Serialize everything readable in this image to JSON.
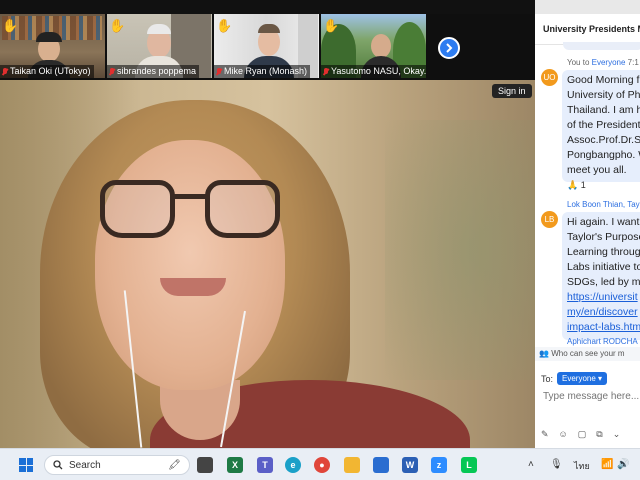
{
  "meeting": {
    "thumbnails": [
      {
        "name": "Taikan Oki (UTokyo)",
        "hand": true,
        "muted": true
      },
      {
        "name": "sibrandes poppema",
        "hand": true,
        "muted": true
      },
      {
        "name": "Mike Ryan (Monash)",
        "hand": true,
        "muted": true
      },
      {
        "name": "Yasutomo NASU, Okay...",
        "hand": true,
        "muted": true
      }
    ],
    "signin_label": "Sign in"
  },
  "chat": {
    "title": "University Presidents M",
    "messages": [
      {
        "avatar": "UO",
        "meta_prefix": "You to",
        "meta_to": "Everyone",
        "meta_time": "7:1",
        "lines": [
          "Good Morning f",
          "University of Ph",
          "Thailand. I am h",
          "of the President",
          "Assoc.Prof.Dr.Su",
          "Pongbangpho. W",
          "meet you all."
        ],
        "reaction": "🙏 1"
      },
      {
        "avatar": "LB",
        "sender": "Lok Boon Thian, Tay",
        "lines": [
          "Hi again. I want",
          "Taylor's Purpose",
          "Learning throug",
          "Labs initiative to",
          "SDGs, led by my"
        ],
        "links": [
          "https://universit",
          "my/en/discover",
          "impact-labs.htm"
        ]
      }
    ],
    "next_sender": "Aphichart RODCHA",
    "who_can_see": "Who can see your m",
    "to_label": "To:",
    "to_value": "Everyone",
    "input_placeholder": "Type message here..."
  },
  "taskbar": {
    "search_placeholder": "Search",
    "tray_lang": "ไทย"
  },
  "colors": {
    "accent": "#2d7cf0",
    "chat_bubble": "#e6eefc",
    "avatar": "#f29a1d"
  }
}
